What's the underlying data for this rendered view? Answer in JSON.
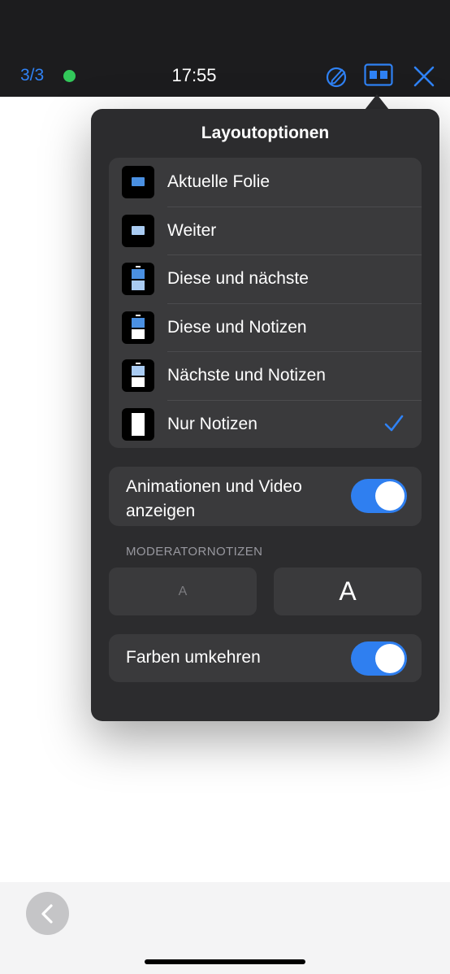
{
  "header": {
    "slide_counter": "3/3",
    "time": "17:55",
    "colors": {
      "accent": "#2f82f5",
      "live": "#32c85a"
    }
  },
  "popover": {
    "title": "Layoutoptionen",
    "layouts": [
      {
        "label": "Aktuelle Folie",
        "icon": "current-slide-icon",
        "selected": false
      },
      {
        "label": "Weiter",
        "icon": "next-slide-icon",
        "selected": false
      },
      {
        "label": "Diese und nächste",
        "icon": "current-and-next-icon",
        "selected": false
      },
      {
        "label": "Diese und Notizen",
        "icon": "current-and-notes-icon",
        "selected": false
      },
      {
        "label": "Nächste und Notizen",
        "icon": "next-and-notes-icon",
        "selected": false
      },
      {
        "label": "Nur Notizen",
        "icon": "notes-only-icon",
        "selected": true
      }
    ],
    "animations_toggle": {
      "label": "Animationen und Video anzeigen",
      "on": true
    },
    "notes_section": {
      "header": "MODERATORNOTIZEN",
      "smaller_label": "A",
      "larger_label": "A"
    },
    "invert_toggle": {
      "label": "Farben umkehren",
      "on": true
    }
  }
}
